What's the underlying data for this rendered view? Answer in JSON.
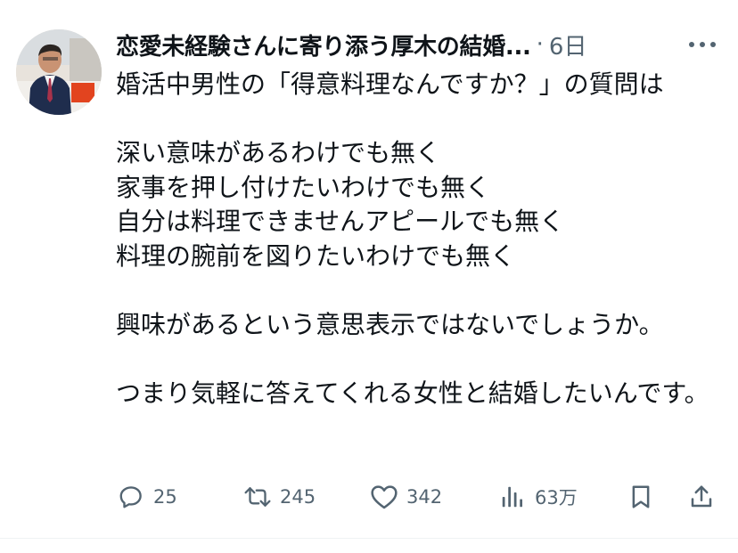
{
  "tweet": {
    "author_name": "恋愛未経験さんに寄り添う厚木の結婚...",
    "separator": "·",
    "timestamp": "6日",
    "body": "婚活中男性の「得意料理なんですか？」の質問は\n\n深い意味があるわけでも無く\n家事を押し付けたいわけでも無く\n自分は料理できませんアピールでも無く\n料理の腕前を図りたいわけでも無く\n\n興味があるという意思表示ではないでしょうか。\n\nつまり気軽に答えてくれる女性と結婚したいんです。"
  },
  "actions": {
    "replies": "25",
    "reposts": "245",
    "likes": "342",
    "views": "63万"
  },
  "icons": {
    "more": "more-icon",
    "reply": "reply-icon",
    "repost": "repost-icon",
    "like": "heart-icon",
    "views": "views-icon",
    "bookmark": "bookmark-icon",
    "share": "share-icon"
  },
  "colors": {
    "text": "#0f1419",
    "muted": "#536471",
    "divider": "#eff3f4"
  }
}
